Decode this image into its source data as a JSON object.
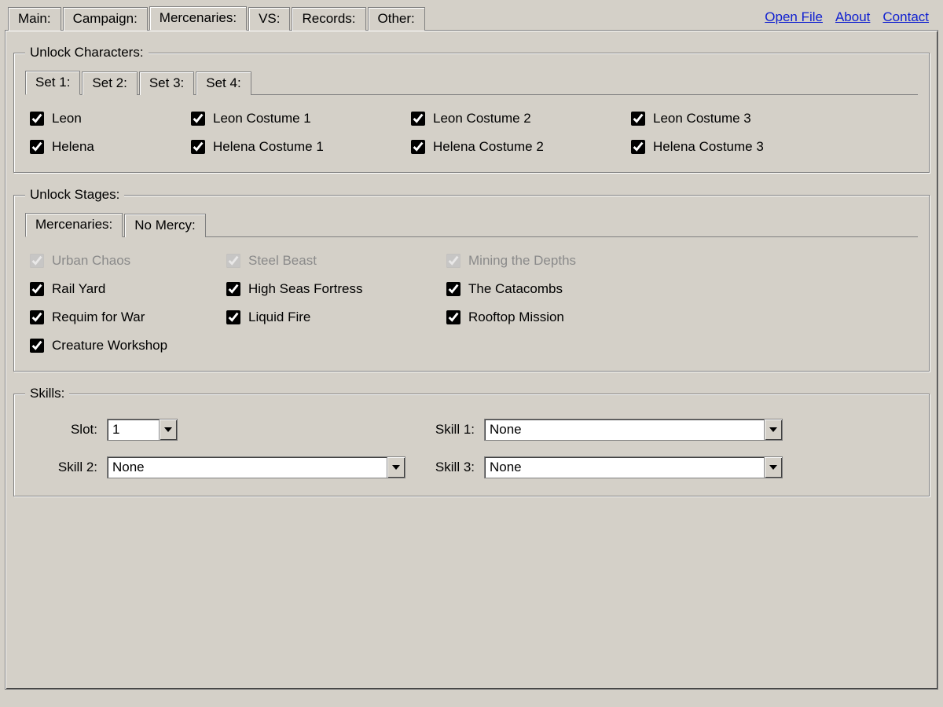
{
  "topTabs": {
    "items": [
      {
        "label": "Main:"
      },
      {
        "label": "Campaign:"
      },
      {
        "label": "Mercenaries:"
      },
      {
        "label": "VS:"
      },
      {
        "label": "Records:"
      },
      {
        "label": "Other:"
      }
    ],
    "activeIndex": 2
  },
  "links": {
    "openFile": "Open File",
    "about": "About",
    "contact": "Contact"
  },
  "unlockCharacters": {
    "legend": "Unlock Characters:",
    "setTabs": [
      {
        "label": "Set 1:"
      },
      {
        "label": "Set 2:"
      },
      {
        "label": "Set 3:"
      },
      {
        "label": "Set 4:"
      }
    ],
    "activeSet": 0,
    "items": [
      {
        "label": "Leon",
        "checked": true
      },
      {
        "label": "Leon Costume 1",
        "checked": true
      },
      {
        "label": "Leon Costume 2",
        "checked": true
      },
      {
        "label": "Leon Costume 3",
        "checked": true
      },
      {
        "label": "Helena",
        "checked": true
      },
      {
        "label": "Helena Costume 1",
        "checked": true
      },
      {
        "label": "Helena Costume 2",
        "checked": true
      },
      {
        "label": "Helena Costume 3",
        "checked": true
      }
    ]
  },
  "unlockStages": {
    "legend": "Unlock Stages:",
    "modeTabs": [
      {
        "label": "Mercenaries:"
      },
      {
        "label": "No Mercy:"
      }
    ],
    "activeMode": 0,
    "items": [
      {
        "label": "Urban Chaos",
        "checked": true,
        "disabled": true
      },
      {
        "label": "Steel Beast",
        "checked": true,
        "disabled": true
      },
      {
        "label": "Mining the Depths",
        "checked": true,
        "disabled": true
      },
      {
        "label": "Rail Yard",
        "checked": true,
        "disabled": false
      },
      {
        "label": "High Seas Fortress",
        "checked": true,
        "disabled": false
      },
      {
        "label": "The Catacombs",
        "checked": true,
        "disabled": false
      },
      {
        "label": "Requim for War",
        "checked": true,
        "disabled": false
      },
      {
        "label": "Liquid Fire",
        "checked": true,
        "disabled": false
      },
      {
        "label": "Rooftop Mission",
        "checked": true,
        "disabled": false
      },
      {
        "label": "Creature Workshop",
        "checked": true,
        "disabled": false
      }
    ]
  },
  "skills": {
    "legend": "Skills:",
    "slotLabel": "Slot:",
    "slotValue": "1",
    "skill1Label": "Skill 1:",
    "skill1Value": "None",
    "skill2Label": "Skill 2:",
    "skill2Value": "None",
    "skill3Label": "Skill 3:",
    "skill3Value": "None"
  }
}
